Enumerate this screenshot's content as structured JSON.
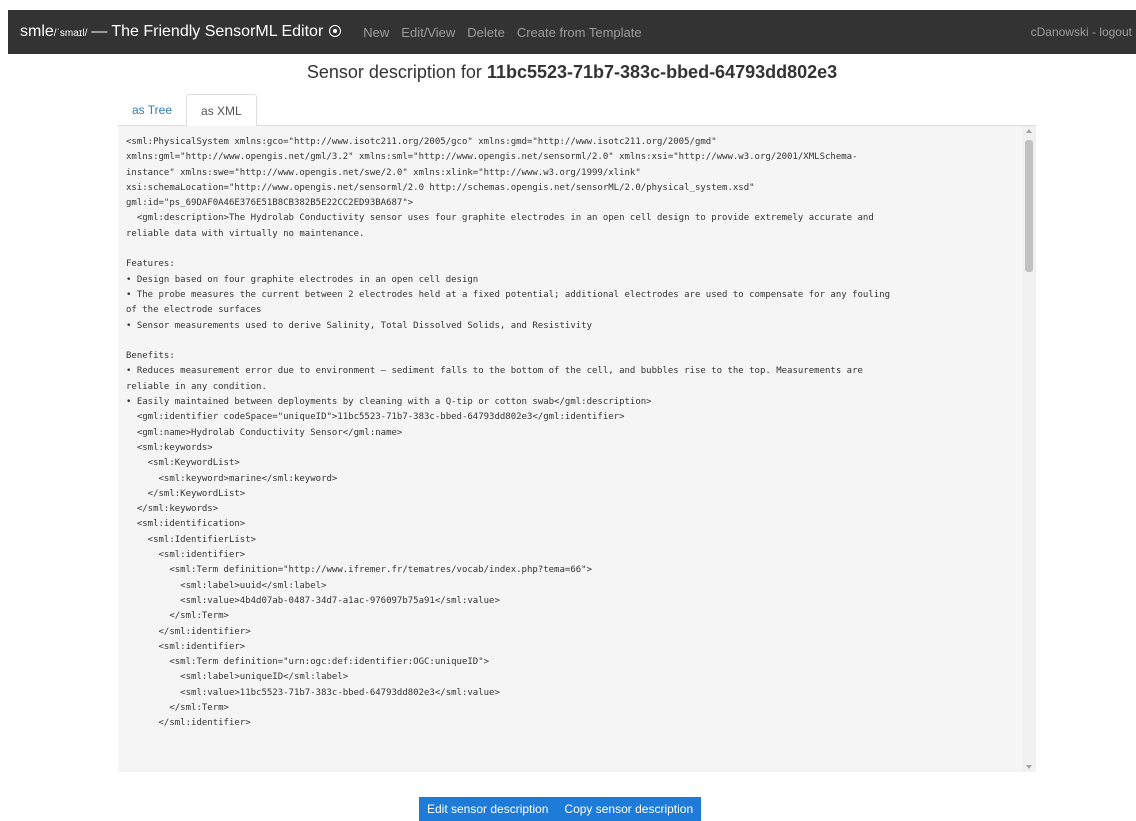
{
  "navbar": {
    "brand_name": "smle",
    "brand_pronunciation": "/ˈsmaɪl/",
    "brand_dash": "—",
    "brand_tagline": "The Friendly SensorML Editor",
    "github_icon": "github-icon",
    "links": [
      "New",
      "Edit/View",
      "Delete",
      "Create from Template"
    ],
    "user": "cDanowski - logout"
  },
  "page": {
    "title_prefix": "Sensor description for",
    "title_id": "11bc5523-71b7-383c-bbed-64793dd802e3"
  },
  "tabs": {
    "tree": "as Tree",
    "xml": "as XML",
    "active": "as XML"
  },
  "xml_lines": [
    "<sml:PhysicalSystem xmlns:gco=\"http://www.isotc211.org/2005/gco\" xmlns:gmd=\"http://www.isotc211.org/2005/gmd\"",
    "xmlns:gml=\"http://www.opengis.net/gml/3.2\" xmlns:sml=\"http://www.opengis.net/sensorml/2.0\" xmlns:xsi=\"http://www.w3.org/2001/XMLSchema-",
    "instance\" xmlns:swe=\"http://www.opengis.net/swe/2.0\" xmlns:xlink=\"http://www.w3.org/1999/xlink\"",
    "xsi:schemaLocation=\"http://www.opengis.net/sensorml/2.0 http://schemas.opengis.net/sensorML/2.0/physical_system.xsd\"",
    "gml:id=\"ps_69DAF0A46E376E51B8CB382B5E22CC2ED93BA687\">",
    "  <gml:description>The Hydrolab Conductivity sensor uses four graphite electrodes in an open cell design to provide extremely accurate and",
    "reliable data with virtually no maintenance.",
    "",
    "Features:",
    "• Design based on four graphite electrodes in an open cell design",
    "• The probe measures the current between 2 electrodes held at a fixed potential; additional electrodes are used to compensate for any fouling",
    "of the electrode surfaces",
    "• Sensor measurements used to derive Salinity, Total Dissolved Solids, and Resistivity",
    "",
    "Benefits:",
    "• Reduces measurement error due to environment – sediment falls to the bottom of the cell, and bubbles rise to the top. Measurements are",
    "reliable in any condition.",
    "• Easily maintained between deployments by cleaning with a Q-tip or cotton swab</gml:description>",
    "  <gml:identifier codeSpace=\"uniqueID\">11bc5523-71b7-383c-bbed-64793dd802e3</gml:identifier>",
    "  <gml:name>Hydrolab Conductivity Sensor</gml:name>",
    "  <sml:keywords>",
    "    <sml:KeywordList>",
    "      <sml:keyword>marine</sml:keyword>",
    "    </sml:KeywordList>",
    "  </sml:keywords>",
    "  <sml:identification>",
    "    <sml:IdentifierList>",
    "      <sml:identifier>",
    "        <sml:Term definition=\"http://www.ifremer.fr/tematres/vocab/index.php?tema=66\">",
    "          <sml:label>uuid</sml:label>",
    "          <sml:value>4b4d07ab-0487-34d7-a1ac-976097b75a91</sml:value>",
    "        </sml:Term>",
    "      </sml:identifier>",
    "      <sml:identifier>",
    "        <sml:Term definition=\"urn:ogc:def:identifier:OGC:uniqueID\">",
    "          <sml:label>uniqueID</sml:label>",
    "          <sml:value>11bc5523-71b7-383c-bbed-64793dd802e3</sml:value>",
    "        </sml:Term>",
    "      </sml:identifier>"
  ],
  "buttons": {
    "edit": "Edit sensor description",
    "copy": "Copy sensor description"
  },
  "colors": {
    "navbar_bg": "#333333",
    "button_bg": "#1f7bd8",
    "link": "#337ab7"
  }
}
